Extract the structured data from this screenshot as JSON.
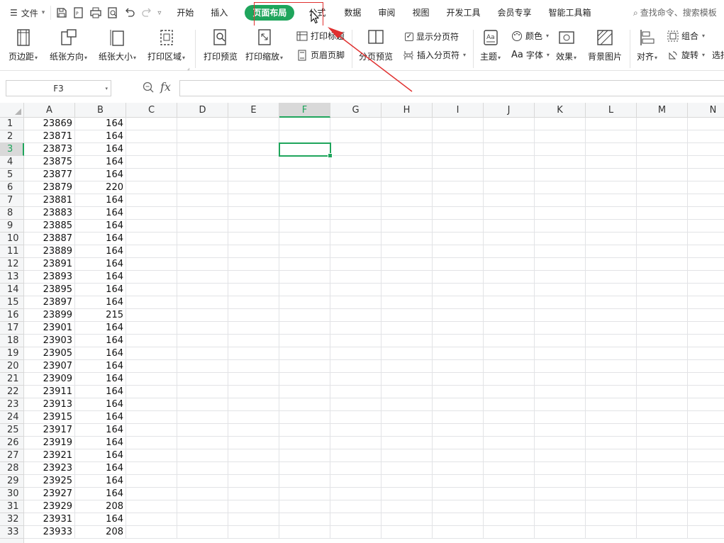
{
  "menubar": {
    "file_label": "文件",
    "tabs": [
      {
        "label": "开始",
        "active": false
      },
      {
        "label": "插入",
        "active": false
      },
      {
        "label": "页面布局",
        "active": true
      },
      {
        "label": "公式",
        "active": false
      },
      {
        "label": "数据",
        "active": false
      },
      {
        "label": "审阅",
        "active": false
      },
      {
        "label": "视图",
        "active": false
      },
      {
        "label": "开发工具",
        "active": false
      },
      {
        "label": "会员专享",
        "active": false
      },
      {
        "label": "智能工具箱",
        "active": false
      }
    ],
    "search_placeholder": "查找命令、搜索模板"
  },
  "ribbon": {
    "margins": "页边距",
    "orientation": "纸张方向",
    "size": "纸张大小",
    "print_area": "打印区域",
    "print_preview": "打印预览",
    "print_scale": "打印缩放",
    "print_titles": "打印标题",
    "header_footer": "页眉页脚",
    "page_break_preview": "分页预览",
    "show_page_breaks": "显示分页符",
    "insert_page_break": "插入分页符",
    "theme": "主题",
    "colors": "颜色",
    "fonts": "字体",
    "effects": "效果",
    "background": "背景图片",
    "align": "对齐",
    "group": "组合",
    "rotate": "旋转",
    "select_pane": "选择"
  },
  "formula_bar": {
    "cell_ref": "F3",
    "fx_label": "fx",
    "formula": ""
  },
  "sheet": {
    "selected_cell": "F3",
    "columns": [
      "A",
      "B",
      "C",
      "D",
      "E",
      "F",
      "G",
      "H",
      "I",
      "J",
      "K",
      "L",
      "M",
      "N"
    ],
    "rows": [
      {
        "n": "1",
        "a": "23869",
        "b": "164"
      },
      {
        "n": "2",
        "a": "23871",
        "b": "164"
      },
      {
        "n": "3",
        "a": "23873",
        "b": "164"
      },
      {
        "n": "4",
        "a": "23875",
        "b": "164"
      },
      {
        "n": "5",
        "a": "23877",
        "b": "164"
      },
      {
        "n": "6",
        "a": "23879",
        "b": "220"
      },
      {
        "n": "7",
        "a": "23881",
        "b": "164"
      },
      {
        "n": "8",
        "a": "23883",
        "b": "164"
      },
      {
        "n": "9",
        "a": "23885",
        "b": "164"
      },
      {
        "n": "10",
        "a": "23887",
        "b": "164"
      },
      {
        "n": "11",
        "a": "23889",
        "b": "164"
      },
      {
        "n": "12",
        "a": "23891",
        "b": "164"
      },
      {
        "n": "13",
        "a": "23893",
        "b": "164"
      },
      {
        "n": "14",
        "a": "23895",
        "b": "164"
      },
      {
        "n": "15",
        "a": "23897",
        "b": "164"
      },
      {
        "n": "16",
        "a": "23899",
        "b": "215"
      },
      {
        "n": "17",
        "a": "23901",
        "b": "164"
      },
      {
        "n": "18",
        "a": "23903",
        "b": "164"
      },
      {
        "n": "19",
        "a": "23905",
        "b": "164"
      },
      {
        "n": "20",
        "a": "23907",
        "b": "164"
      },
      {
        "n": "21",
        "a": "23909",
        "b": "164"
      },
      {
        "n": "22",
        "a": "23911",
        "b": "164"
      },
      {
        "n": "23",
        "a": "23913",
        "b": "164"
      },
      {
        "n": "24",
        "a": "23915",
        "b": "164"
      },
      {
        "n": "25",
        "a": "23917",
        "b": "164"
      },
      {
        "n": "26",
        "a": "23919",
        "b": "164"
      },
      {
        "n": "27",
        "a": "23921",
        "b": "164"
      },
      {
        "n": "28",
        "a": "23923",
        "b": "164"
      },
      {
        "n": "29",
        "a": "23925",
        "b": "164"
      },
      {
        "n": "30",
        "a": "23927",
        "b": "164"
      },
      {
        "n": "31",
        "a": "23929",
        "b": "208"
      },
      {
        "n": "32",
        "a": "23931",
        "b": "164"
      },
      {
        "n": "33",
        "a": "23933",
        "b": "208"
      }
    ]
  },
  "colors": {
    "accent": "#1fa55c",
    "annotation": "#e0302f"
  }
}
